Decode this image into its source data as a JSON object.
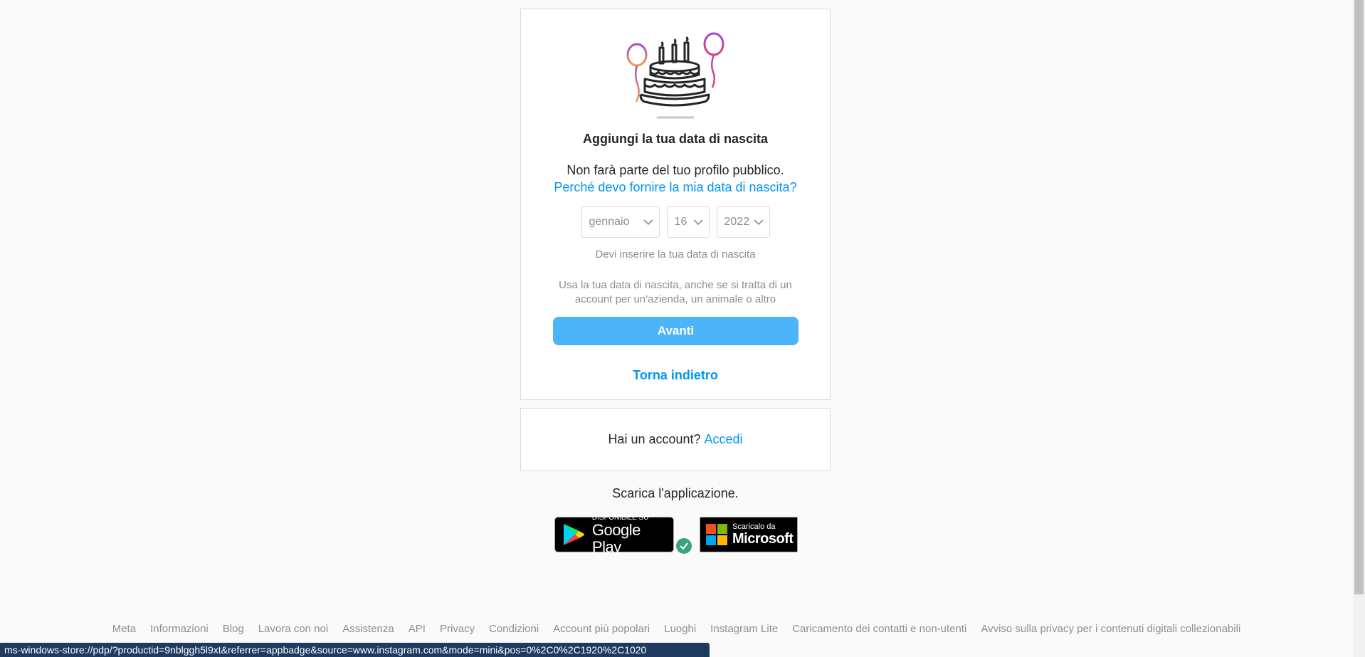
{
  "signup": {
    "title": "Aggiungi la tua data di nascita",
    "subtitle": "Non farà parte del tuo profilo pubblico.",
    "why_link": "Perché devo fornire la mia data di nascita?",
    "birthday": {
      "month": "gennaio",
      "day": "16",
      "year": "2022"
    },
    "error": "Devi inserire la tua data di nascita",
    "note": "Usa la tua data di nascita, anche se si tratta di un account per un'azienda, un animale o altro",
    "next_button": "Avanti",
    "back_link": "Torna indietro"
  },
  "login_card": {
    "text": "Hai un account?",
    "link": "Accedi"
  },
  "download": {
    "text": "Scarica l'applicazione.",
    "google": {
      "small": "DISPONIBILE SU",
      "big": "Google Play"
    },
    "microsoft": {
      "small": "Scaricalo da",
      "big": "Microsoft"
    }
  },
  "footer": {
    "links": [
      "Meta",
      "Informazioni",
      "Blog",
      "Lavora con noi",
      "Assistenza",
      "API",
      "Privacy",
      "Condizioni",
      "Account più popolari",
      "Luoghi",
      "Instagram Lite",
      "Caricamento dei contatti e non-utenti",
      "Avviso sulla privacy per i contenuti digitali collezionabili"
    ]
  },
  "status_bar": {
    "url": "ms-windows-store://pdp/?productid=9nblggh5l9xt&referrer=appbadge&source=www.instagram.com&mode=mini&pos=0%2C0%2C1920%2C1020"
  },
  "colors": {
    "accent": "#0095f6",
    "button": "#4cb5f9",
    "muted": "#8e8e8e",
    "border": "#dbdbdb"
  }
}
